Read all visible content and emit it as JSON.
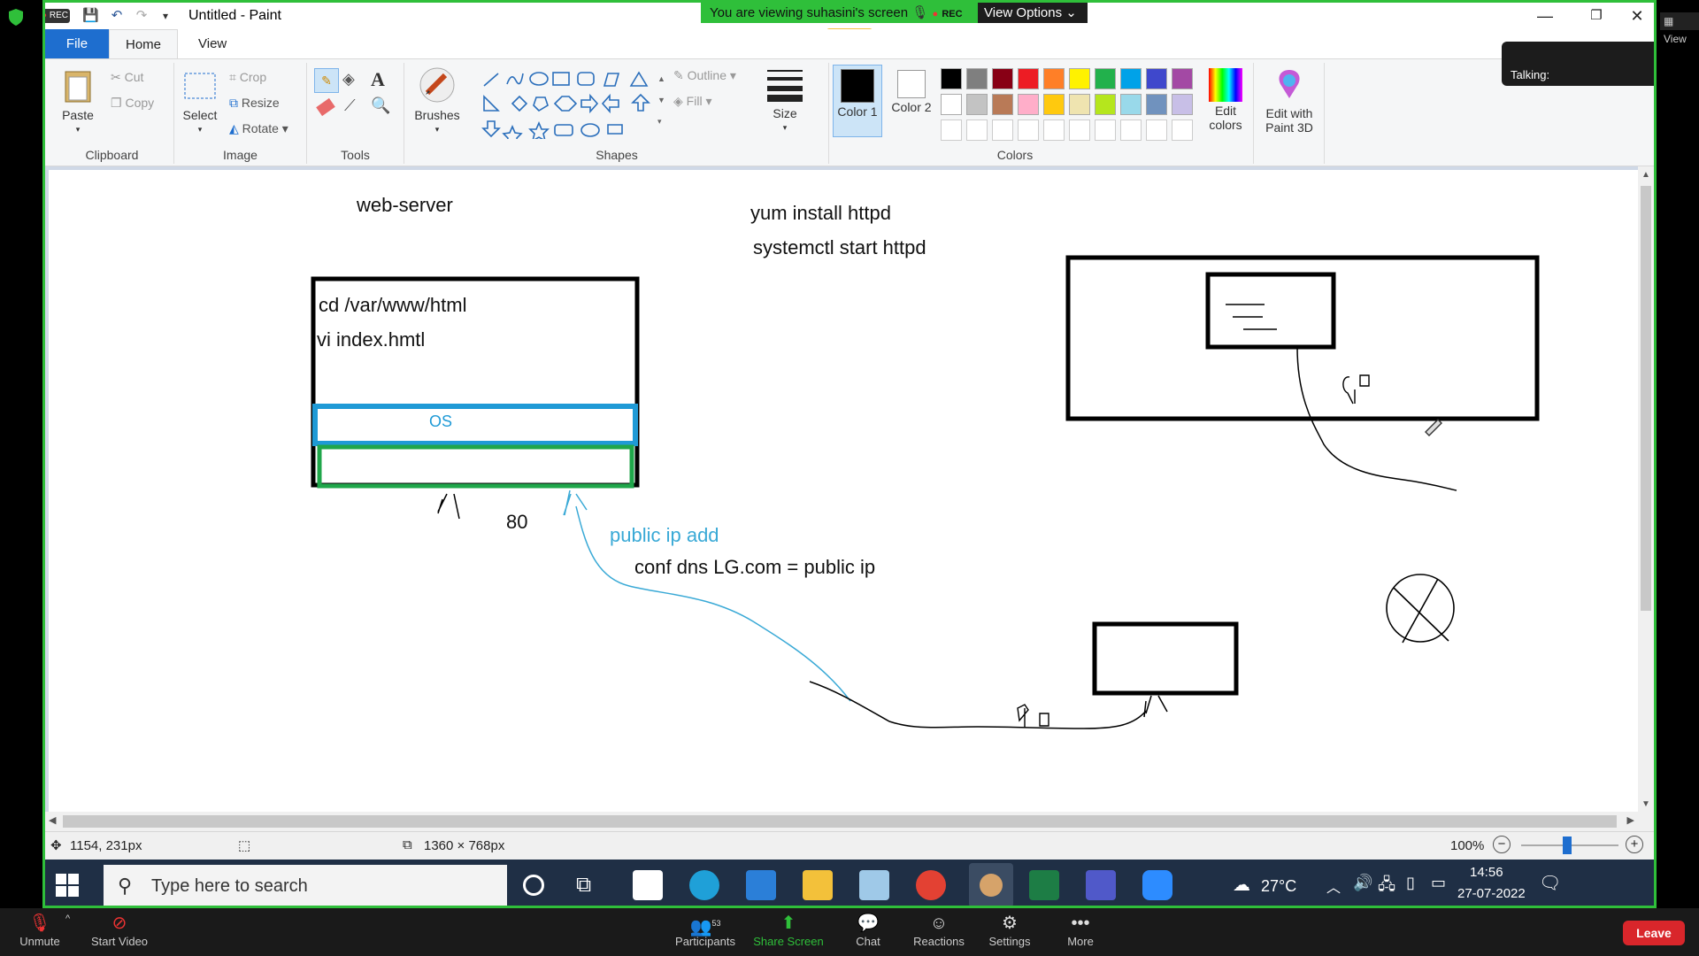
{
  "zoom": {
    "rec_label": "REC",
    "banner": "You are viewing suhasini's screen",
    "banner_rec": "REC",
    "view_options": "View Options",
    "talking": "Talking:",
    "view_corner": "View",
    "meeting_bar": {
      "unmute": "Unmute",
      "start_video": "Start Video",
      "participants": "Participants",
      "participants_count": "53",
      "share_screen": "Share Screen",
      "chat": "Chat",
      "reactions": "Reactions",
      "settings": "Settings",
      "more": "More",
      "leave": "Leave"
    }
  },
  "window": {
    "title": "Untitled - Paint"
  },
  "tabs": {
    "file": "File",
    "home": "Home",
    "view": "View"
  },
  "ribbon": {
    "clipboard": {
      "label": "Clipboard",
      "paste": "Paste",
      "cut": "Cut",
      "copy": "Copy"
    },
    "image": {
      "label": "Image",
      "select": "Select",
      "crop": "Crop",
      "resize": "Resize",
      "rotate": "Rotate"
    },
    "tools": {
      "label": "Tools"
    },
    "brushes": {
      "label": "Brushes"
    },
    "shapes": {
      "label": "Shapes",
      "outline": "Outline",
      "fill": "Fill"
    },
    "size": {
      "label": "Size"
    },
    "colors": {
      "label": "Colors",
      "color1": "Color 1",
      "color2": "Color 2",
      "edit_colors": "Edit colors",
      "edit_3d": "Edit with Paint 3D",
      "row1": [
        "#000000",
        "#7f7f7f",
        "#880015",
        "#ed1c24",
        "#ff7f27",
        "#fff200",
        "#22b14c",
        "#00a2e8",
        "#3f48cc",
        "#a349a4"
      ],
      "row2": [
        "#ffffff",
        "#c3c3c3",
        "#b97a57",
        "#ffaec9",
        "#ffc90e",
        "#efe4b0",
        "#b5e61d",
        "#99d9ea",
        "#7092be",
        "#c8bfe7"
      ]
    }
  },
  "canvas": {
    "web_server": "web-server",
    "yum": "yum install httpd",
    "systemctl": "systemctl  start  httpd",
    "cd_line": "cd  /var/www/html",
    "vi_line": "vi  index.hmtl",
    "os": "OS",
    "port": "80",
    "public_ip": "public ip add",
    "conf_dns": "conf dns LG.com   = public ip"
  },
  "status": {
    "cursor_pos": "1154, 231px",
    "canvas_size": "1360 × 768px",
    "zoom": "100%"
  },
  "taskbar": {
    "search_placeholder": "Type here to search",
    "temperature": "27°C",
    "time": "14:56",
    "date": "27-07-2022"
  }
}
